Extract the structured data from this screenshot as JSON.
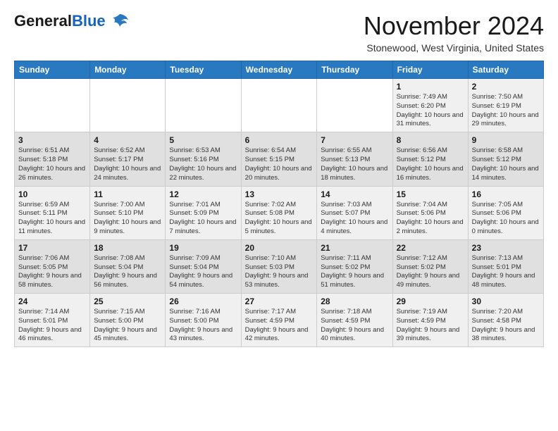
{
  "header": {
    "logo_general": "General",
    "logo_blue": "Blue",
    "month": "November 2024",
    "location": "Stonewood, West Virginia, United States"
  },
  "weekdays": [
    "Sunday",
    "Monday",
    "Tuesday",
    "Wednesday",
    "Thursday",
    "Friday",
    "Saturday"
  ],
  "weeks": [
    [
      {
        "day": "",
        "info": ""
      },
      {
        "day": "",
        "info": ""
      },
      {
        "day": "",
        "info": ""
      },
      {
        "day": "",
        "info": ""
      },
      {
        "day": "",
        "info": ""
      },
      {
        "day": "1",
        "info": "Sunrise: 7:49 AM\nSunset: 6:20 PM\nDaylight: 10 hours\nand 31 minutes."
      },
      {
        "day": "2",
        "info": "Sunrise: 7:50 AM\nSunset: 6:19 PM\nDaylight: 10 hours\nand 29 minutes."
      }
    ],
    [
      {
        "day": "3",
        "info": "Sunrise: 6:51 AM\nSunset: 5:18 PM\nDaylight: 10 hours\nand 26 minutes."
      },
      {
        "day": "4",
        "info": "Sunrise: 6:52 AM\nSunset: 5:17 PM\nDaylight: 10 hours\nand 24 minutes."
      },
      {
        "day": "5",
        "info": "Sunrise: 6:53 AM\nSunset: 5:16 PM\nDaylight: 10 hours\nand 22 minutes."
      },
      {
        "day": "6",
        "info": "Sunrise: 6:54 AM\nSunset: 5:15 PM\nDaylight: 10 hours\nand 20 minutes."
      },
      {
        "day": "7",
        "info": "Sunrise: 6:55 AM\nSunset: 5:13 PM\nDaylight: 10 hours\nand 18 minutes."
      },
      {
        "day": "8",
        "info": "Sunrise: 6:56 AM\nSunset: 5:12 PM\nDaylight: 10 hours\nand 16 minutes."
      },
      {
        "day": "9",
        "info": "Sunrise: 6:58 AM\nSunset: 5:12 PM\nDaylight: 10 hours\nand 14 minutes."
      }
    ],
    [
      {
        "day": "10",
        "info": "Sunrise: 6:59 AM\nSunset: 5:11 PM\nDaylight: 10 hours\nand 11 minutes."
      },
      {
        "day": "11",
        "info": "Sunrise: 7:00 AM\nSunset: 5:10 PM\nDaylight: 10 hours\nand 9 minutes."
      },
      {
        "day": "12",
        "info": "Sunrise: 7:01 AM\nSunset: 5:09 PM\nDaylight: 10 hours\nand 7 minutes."
      },
      {
        "day": "13",
        "info": "Sunrise: 7:02 AM\nSunset: 5:08 PM\nDaylight: 10 hours\nand 5 minutes."
      },
      {
        "day": "14",
        "info": "Sunrise: 7:03 AM\nSunset: 5:07 PM\nDaylight: 10 hours\nand 4 minutes."
      },
      {
        "day": "15",
        "info": "Sunrise: 7:04 AM\nSunset: 5:06 PM\nDaylight: 10 hours\nand 2 minutes."
      },
      {
        "day": "16",
        "info": "Sunrise: 7:05 AM\nSunset: 5:06 PM\nDaylight: 10 hours\nand 0 minutes."
      }
    ],
    [
      {
        "day": "17",
        "info": "Sunrise: 7:06 AM\nSunset: 5:05 PM\nDaylight: 9 hours\nand 58 minutes."
      },
      {
        "day": "18",
        "info": "Sunrise: 7:08 AM\nSunset: 5:04 PM\nDaylight: 9 hours\nand 56 minutes."
      },
      {
        "day": "19",
        "info": "Sunrise: 7:09 AM\nSunset: 5:04 PM\nDaylight: 9 hours\nand 54 minutes."
      },
      {
        "day": "20",
        "info": "Sunrise: 7:10 AM\nSunset: 5:03 PM\nDaylight: 9 hours\nand 53 minutes."
      },
      {
        "day": "21",
        "info": "Sunrise: 7:11 AM\nSunset: 5:02 PM\nDaylight: 9 hours\nand 51 minutes."
      },
      {
        "day": "22",
        "info": "Sunrise: 7:12 AM\nSunset: 5:02 PM\nDaylight: 9 hours\nand 49 minutes."
      },
      {
        "day": "23",
        "info": "Sunrise: 7:13 AM\nSunset: 5:01 PM\nDaylight: 9 hours\nand 48 minutes."
      }
    ],
    [
      {
        "day": "24",
        "info": "Sunrise: 7:14 AM\nSunset: 5:01 PM\nDaylight: 9 hours\nand 46 minutes."
      },
      {
        "day": "25",
        "info": "Sunrise: 7:15 AM\nSunset: 5:00 PM\nDaylight: 9 hours\nand 45 minutes."
      },
      {
        "day": "26",
        "info": "Sunrise: 7:16 AM\nSunset: 5:00 PM\nDaylight: 9 hours\nand 43 minutes."
      },
      {
        "day": "27",
        "info": "Sunrise: 7:17 AM\nSunset: 4:59 PM\nDaylight: 9 hours\nand 42 minutes."
      },
      {
        "day": "28",
        "info": "Sunrise: 7:18 AM\nSunset: 4:59 PM\nDaylight: 9 hours\nand 40 minutes."
      },
      {
        "day": "29",
        "info": "Sunrise: 7:19 AM\nSunset: 4:59 PM\nDaylight: 9 hours\nand 39 minutes."
      },
      {
        "day": "30",
        "info": "Sunrise: 7:20 AM\nSunset: 4:58 PM\nDaylight: 9 hours\nand 38 minutes."
      }
    ]
  ]
}
